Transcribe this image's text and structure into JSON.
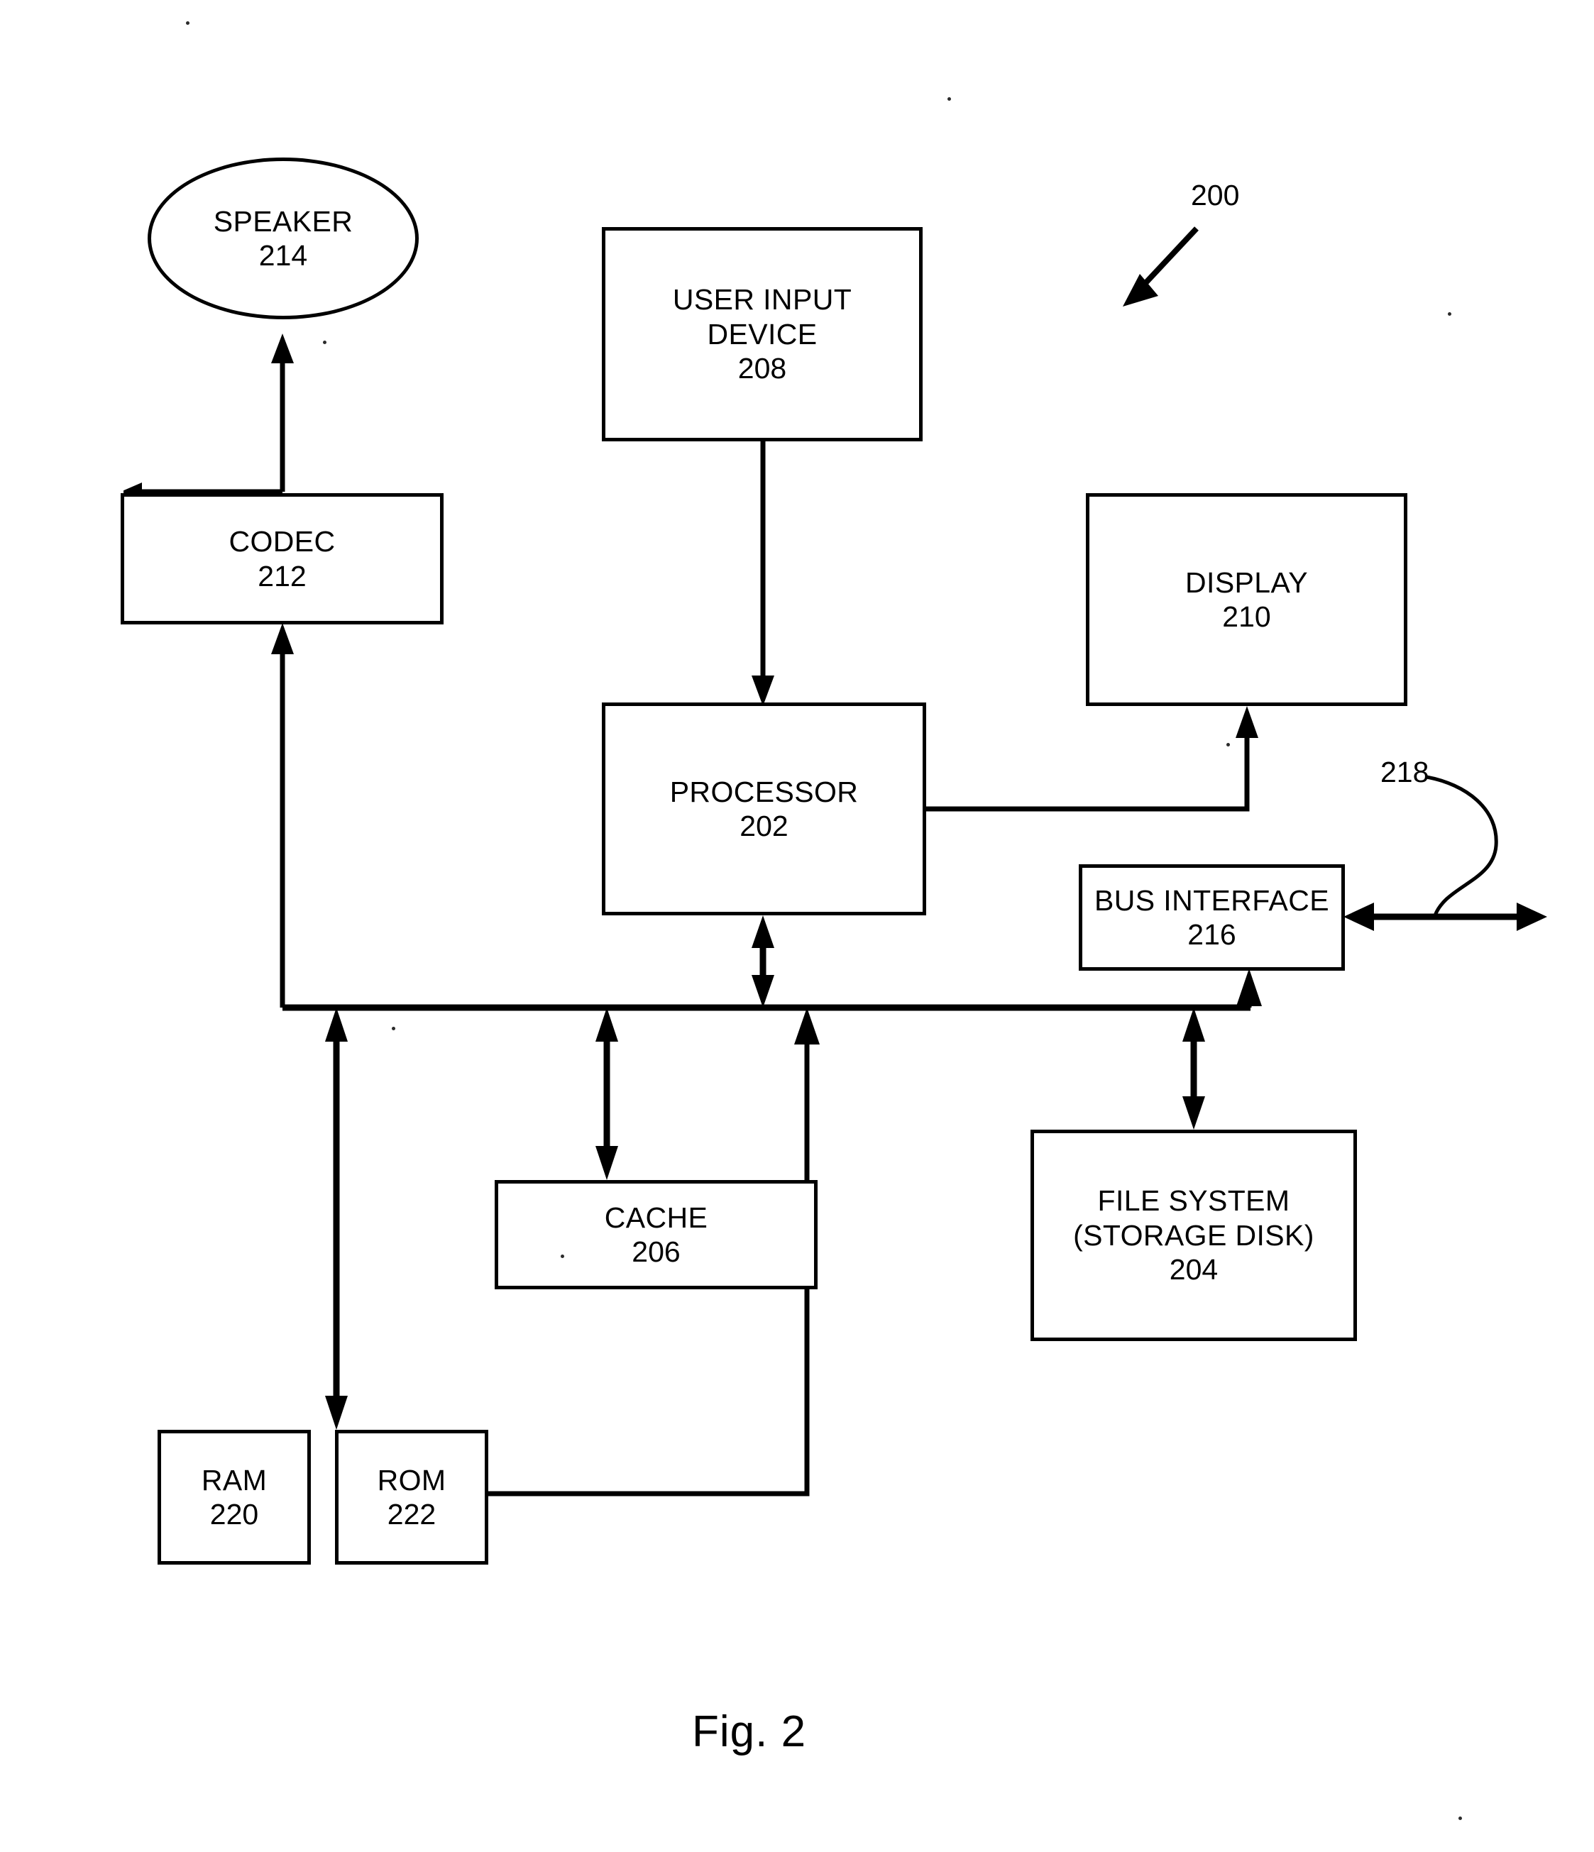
{
  "figure": {
    "caption": "Fig. 2",
    "system_ref": "200",
    "bus_ref": "218"
  },
  "nodes": [
    {
      "id": "speaker",
      "shape": "ellipse",
      "label": "SPEAKER",
      "ref": "214"
    },
    {
      "id": "user-input-device",
      "shape": "rect",
      "label_line1": "USER INPUT",
      "label_line2": "DEVICE",
      "ref": "208"
    },
    {
      "id": "codec",
      "shape": "rect",
      "label": "CODEC",
      "ref": "212"
    },
    {
      "id": "display",
      "shape": "rect",
      "label": "DISPLAY",
      "ref": "210"
    },
    {
      "id": "processor",
      "shape": "rect",
      "label": "PROCESSOR",
      "ref": "202"
    },
    {
      "id": "bus-interface",
      "shape": "rect",
      "label": "BUS INTERFACE",
      "ref": "216"
    },
    {
      "id": "cache",
      "shape": "rect",
      "label": "CACHE",
      "ref": "206"
    },
    {
      "id": "file-system",
      "shape": "rect",
      "label_line1": "FILE SYSTEM",
      "label_line2": "(STORAGE DISK)",
      "ref": "204"
    },
    {
      "id": "ram",
      "shape": "rect",
      "label": "RAM",
      "ref": "220"
    },
    {
      "id": "rom",
      "shape": "rect",
      "label": "ROM",
      "ref": "222"
    }
  ],
  "colors": {
    "line": "#000000",
    "background": "#ffffff"
  }
}
